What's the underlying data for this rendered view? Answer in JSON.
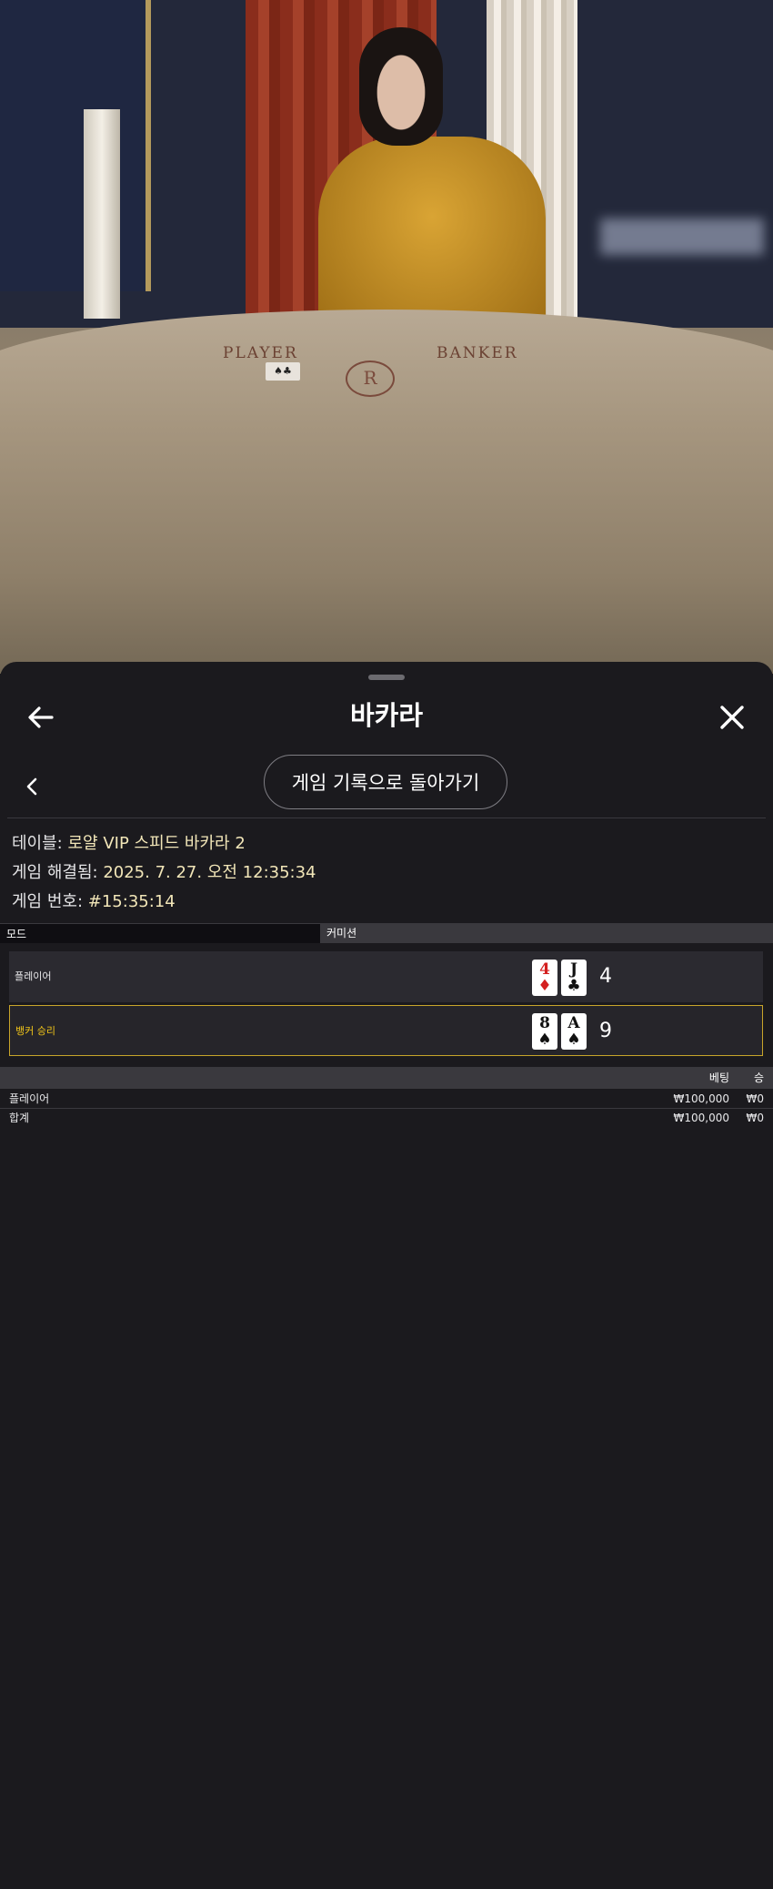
{
  "video": {
    "table_left_label": "PLAYER",
    "table_right_label": "BANKER",
    "table_logo": "R"
  },
  "header": {
    "title": "바카라",
    "back_icon": "arrow-left-icon",
    "close_icon": "close-icon"
  },
  "nav": {
    "prev_icon": "chevron-left-icon",
    "back_to_history_label": "게임 기록으로 돌아가기"
  },
  "info": {
    "table_label": "테이블:",
    "table_value": "로얄 VIP 스피드 바카라 2",
    "resolved_label": "게임 해결됨:",
    "resolved_value": "2025. 7. 27. 오전 12:35:34",
    "number_label": "게임 번호:",
    "number_value": "#15:35:14"
  },
  "mode_bar": {
    "mode_label": "모드",
    "mode_value": "커미션"
  },
  "results": {
    "player": {
      "label": "플레이어",
      "cards": [
        {
          "rank": "4",
          "suit": "♦",
          "color": "red"
        },
        {
          "rank": "J",
          "suit": "♣",
          "color": "black"
        }
      ],
      "score": "4"
    },
    "banker": {
      "label": "뱅커 승리",
      "cards": [
        {
          "rank": "8",
          "suit": "♠",
          "color": "black"
        },
        {
          "rank": "A",
          "suit": "♠",
          "color": "black"
        }
      ],
      "score": "9"
    }
  },
  "bets": {
    "header_bet": "베팅",
    "header_win": "승",
    "rows": [
      {
        "name": "플레이어",
        "bet": "₩100,000",
        "win": "₩0"
      },
      {
        "name": "합계",
        "bet": "₩100,000",
        "win": "₩0"
      }
    ]
  },
  "colors": {
    "sheet_bg": "#1b1a1e",
    "highlight_gold": "#c8a52a",
    "banker_label": "#f0c419",
    "info_value": "#f2e6b8"
  }
}
